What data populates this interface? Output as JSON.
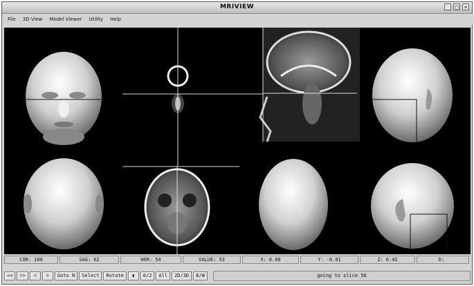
{
  "window": {
    "title": "MRIVIEW"
  },
  "menu": [
    "File",
    "3D View",
    "Model Viewer",
    "Utility",
    "Help"
  ],
  "status": [
    {
      "label": "COR:",
      "value": "100"
    },
    {
      "label": "SAG:",
      "value": "62"
    },
    {
      "label": "HOR:",
      "value": "54"
    },
    {
      "label": "VALUE:",
      "value": "53"
    },
    {
      "label": "X:",
      "value": "0.00"
    },
    {
      "label": "Y:",
      "value": "-0.01"
    },
    {
      "label": "Z:",
      "value": "0.42"
    },
    {
      "label": "D:",
      "value": ""
    }
  ],
  "toolbar": [
    "<<",
    ">>",
    "<",
    ">",
    "Goto N",
    "Select",
    "Rotate",
    "▮",
    "0/2",
    "All",
    "2D/3D",
    "B/W"
  ],
  "message": "going to slice 56"
}
